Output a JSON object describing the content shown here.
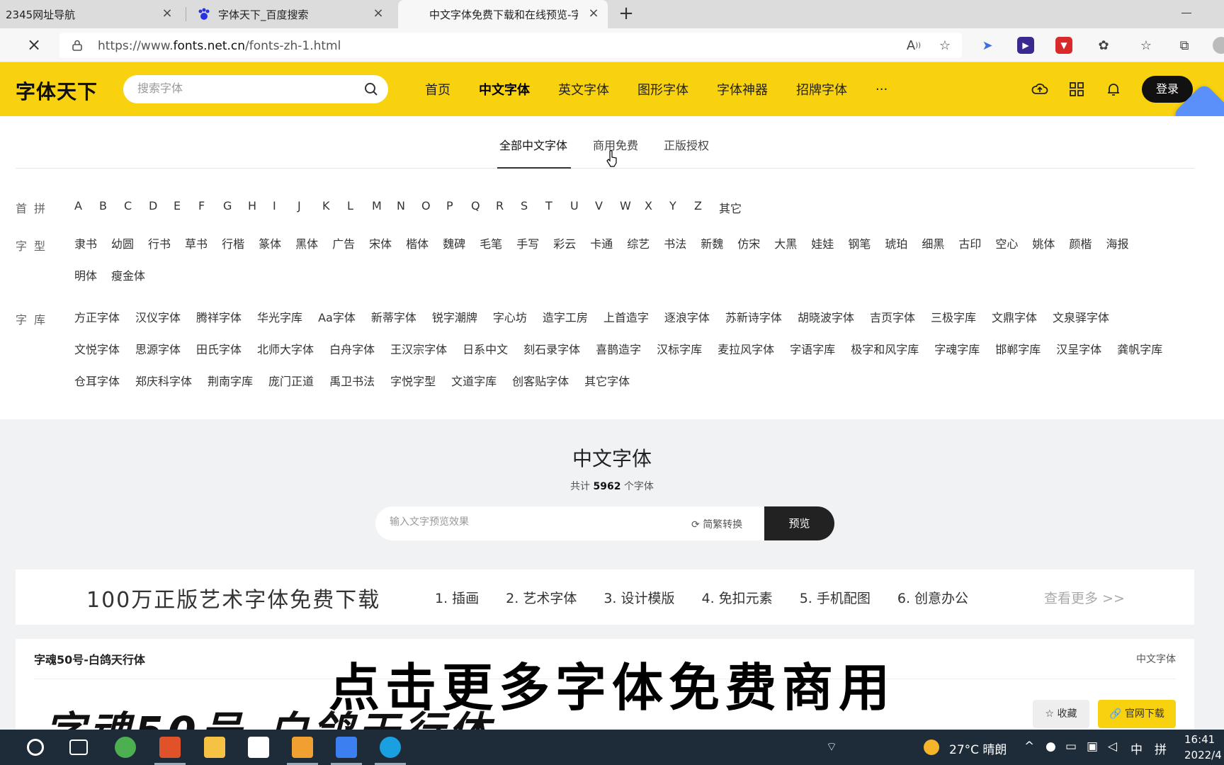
{
  "browser": {
    "tabs": [
      {
        "title": "2345网址导航"
      },
      {
        "title": "字体天下_百度搜索"
      },
      {
        "title": "中文字体免费下载和在线预览-字"
      }
    ],
    "url_prefix": "https://www.",
    "url_domain": "fonts.net.cn",
    "url_path": "/fonts-zh-1.html"
  },
  "site": {
    "logo": "字体天下",
    "search_placeholder": "搜索字体",
    "nav": [
      "首页",
      "中文字体",
      "英文字体",
      "图形字体",
      "字体神器",
      "招牌字体",
      "···"
    ],
    "login": "登录"
  },
  "subtabs": [
    "全部中文字体",
    "商用免费",
    "正版授权"
  ],
  "filters": {
    "pinyin_label": "首拼",
    "pinyin": [
      "A",
      "B",
      "C",
      "D",
      "E",
      "F",
      "G",
      "H",
      "I",
      "J",
      "K",
      "L",
      "M",
      "N",
      "O",
      "P",
      "Q",
      "R",
      "S",
      "T",
      "U",
      "V",
      "W",
      "X",
      "Y",
      "Z",
      "其它"
    ],
    "type_label": "字型",
    "types": [
      "隶书",
      "幼圆",
      "行书",
      "草书",
      "行楷",
      "篆体",
      "黑体",
      "广告",
      "宋体",
      "楷体",
      "魏碑",
      "毛笔",
      "手写",
      "彩云",
      "卡通",
      "综艺",
      "书法",
      "新魏",
      "仿宋",
      "大黑",
      "娃娃",
      "钢笔",
      "琥珀",
      "细黑",
      "古印",
      "空心",
      "姚体",
      "颜楷",
      "海报",
      "明体",
      "瘦金体"
    ],
    "lib_label": "字库",
    "libs": [
      "方正字体",
      "汉仪字体",
      "腾祥字体",
      "华光字库",
      "Aa字体",
      "新蒂字体",
      "锐字潮牌",
      "字心坊",
      "造字工房",
      "上首造字",
      "逐浪字体",
      "苏新诗字体",
      "胡晓波字体",
      "吉页字体",
      "三极字库",
      "文鼎字体",
      "文泉驿字体",
      "文悦字体",
      "思源字体",
      "田氏字体",
      "北师大字体",
      "白舟字体",
      "王汉宗字体",
      "日系中文",
      "刻石录字体",
      "喜鹊造字",
      "汉标字库",
      "麦拉风字体",
      "字语字库",
      "极字和风字库",
      "字魂字库",
      "邯郸字库",
      "汉呈字体",
      "龚帆字库",
      "仓耳字体",
      "郑庆科字体",
      "荆南字库",
      "庞门正道",
      "禹卫书法",
      "字悦字型",
      "文道字库",
      "创客贴字体",
      "其它字体"
    ]
  },
  "listing": {
    "title": "中文字体",
    "count_prefix": "共计",
    "count": "5962",
    "count_suffix": "个字体",
    "preview_placeholder": "输入文字预览效果",
    "convert": "简繁转换",
    "preview_btn": "预览"
  },
  "banner": {
    "title": "100万正版艺术字体免费下载",
    "items": [
      "1. 插画",
      "2. 艺术字体",
      "3. 设计模版",
      "4. 免扣元素",
      "5. 手机配图",
      "6. 创意办公"
    ],
    "more": "查看更多 >>"
  },
  "card": {
    "name": "字魂50号-白鸽天行体",
    "category": "中文字体",
    "preview_text": "字魂50号-白鸽天行体",
    "fav": "收藏",
    "download": "官网下载"
  },
  "overlay": "点击更多字体免费商用",
  "taskbar": {
    "weather": "27°C 晴朗",
    "ime1": "中",
    "ime2": "拼",
    "time": "16:41",
    "date": "2022/4"
  },
  "colors": {
    "brand_yellow": "#f8d20f",
    "dark": "#222222"
  }
}
